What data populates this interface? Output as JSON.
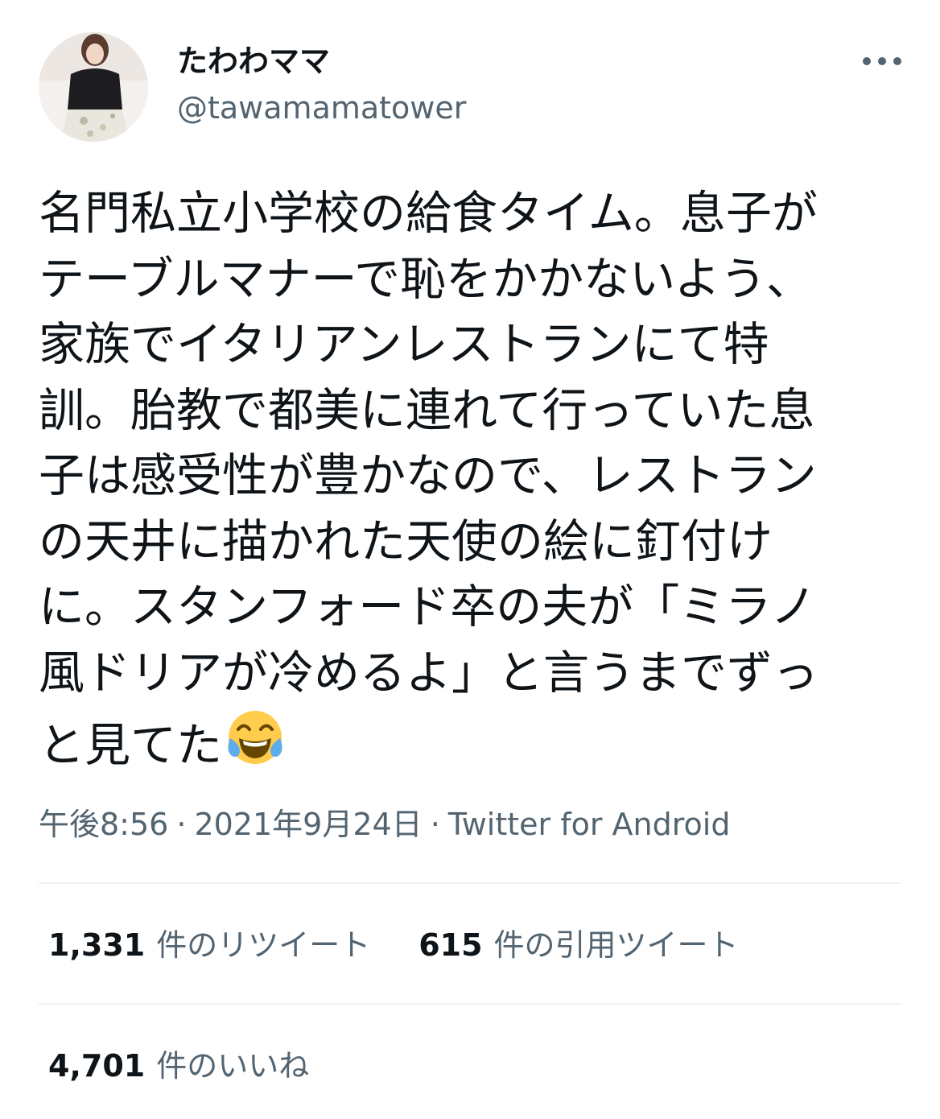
{
  "tweet": {
    "author": {
      "display_name": "たわわママ",
      "handle": "@tawamamatower"
    },
    "text_lines": [
      "名門私立小学校の給食タイム。息子が",
      "テーブルマナーで恥をかかないよう、",
      "家族でイタリアンレストランにて特",
      "訓。胎教で都美に連れて行っていた息",
      "子は感受性が豊かなので、レストラン",
      "の天井に描かれた天使の絵に釘付け",
      "に。スタンフォード卒の夫が「ミラノ",
      "風ドリアが冷めるよ」と言うまでずっ",
      "と見てた"
    ],
    "emoji": "face-with-tears-of-joy",
    "meta": {
      "time": "午後8:56",
      "separator": "·",
      "date": "2021年9月24日",
      "source": "Twitter for Android"
    },
    "stats": {
      "retweets": {
        "count": "1,331",
        "label": "件のリツイート"
      },
      "quotes": {
        "count": "615",
        "label": "件の引用ツイート"
      },
      "likes": {
        "count": "4,701",
        "label": "件のいいね"
      }
    }
  },
  "colors": {
    "text": "#0f1419",
    "secondary": "#536471",
    "divider": "#eff3f4"
  }
}
